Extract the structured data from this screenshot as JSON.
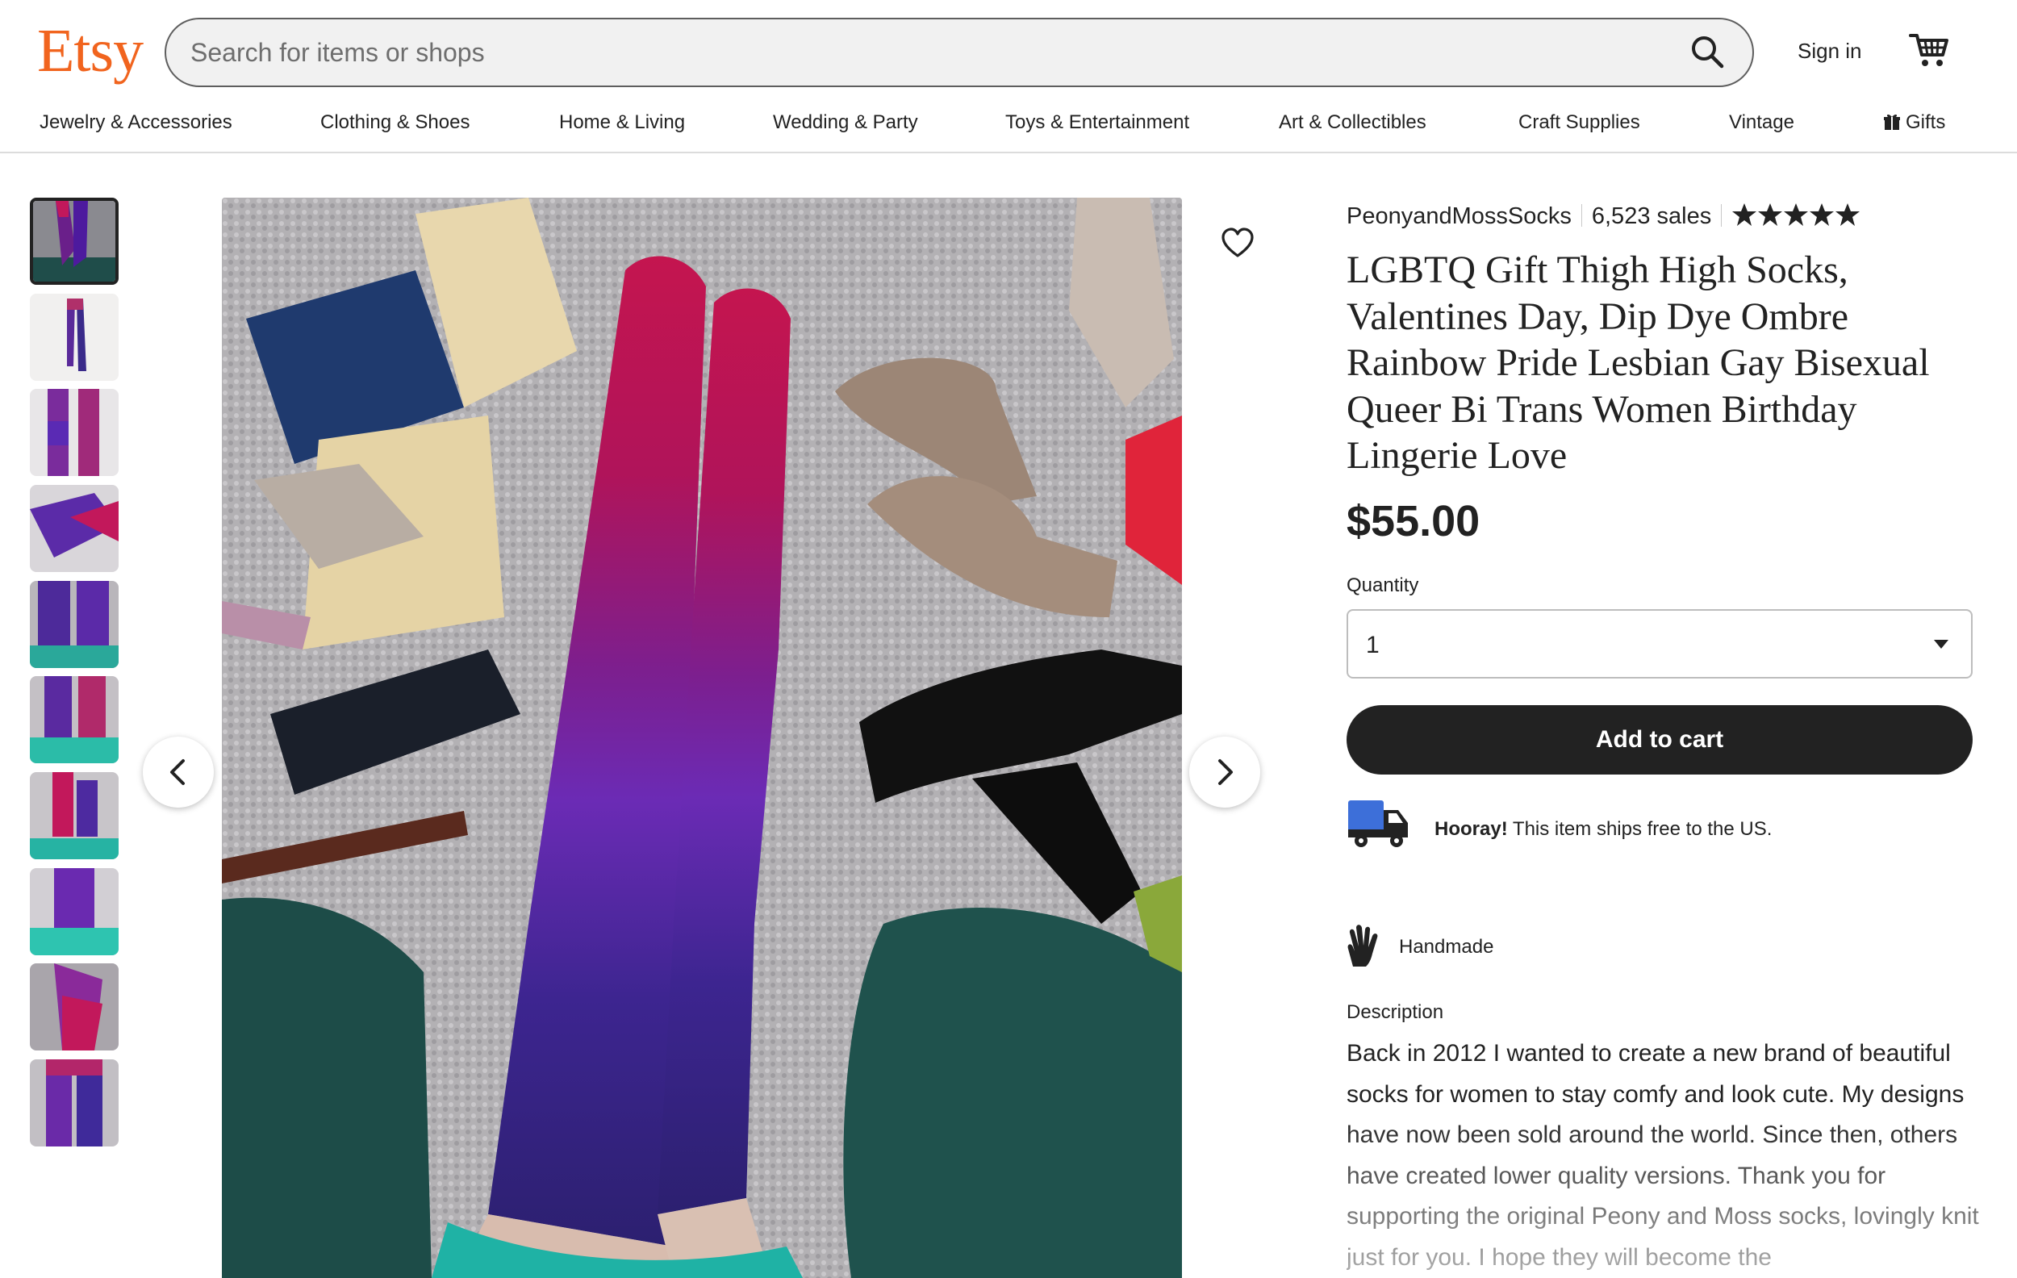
{
  "header": {
    "logo": "Etsy",
    "search_placeholder": "Search for items or shops",
    "sign_in": "Sign in",
    "cart_icon": "cart-icon",
    "search_icon": "search-icon"
  },
  "nav": {
    "items": [
      "Jewelry & Accessories",
      "Clothing & Shoes",
      "Home & Living",
      "Wedding & Party",
      "Toys & Entertainment",
      "Art & Collectibles",
      "Craft Supplies",
      "Vintage",
      "Gifts"
    ]
  },
  "gallery": {
    "thumbnail_count": 10,
    "selected_index": 0
  },
  "listing": {
    "shop_name": "PeonyandMossSocks",
    "sales": "6,523 sales",
    "rating": 5,
    "title": "LGBTQ Gift Thigh High Socks, Valentines Day, Dip Dye Ombre Rainbow Pride Lesbian Gay Bisexual Queer Bi Trans Women Birthday Lingerie Love",
    "price": "$55.00",
    "quantity_label": "Quantity",
    "quantity_value": "1",
    "add_to_cart": "Add to cart",
    "shipping_bold": "Hooray!",
    "shipping_text": " This item ships free to the US.",
    "handmade": "Handmade",
    "description_label": "Description",
    "description": "Back in 2012 I wanted to create a new brand of beautiful socks for women to stay comfy and look cute. My designs have now been sold around the world. Since then, others have created lower quality versions. Thank you for supporting the original Peony and Moss socks, lovingly knit just for you. I hope they will become the"
  },
  "colors": {
    "brand": "#f1641e",
    "button": "#222222",
    "truck_blue": "#3d6fd9"
  }
}
